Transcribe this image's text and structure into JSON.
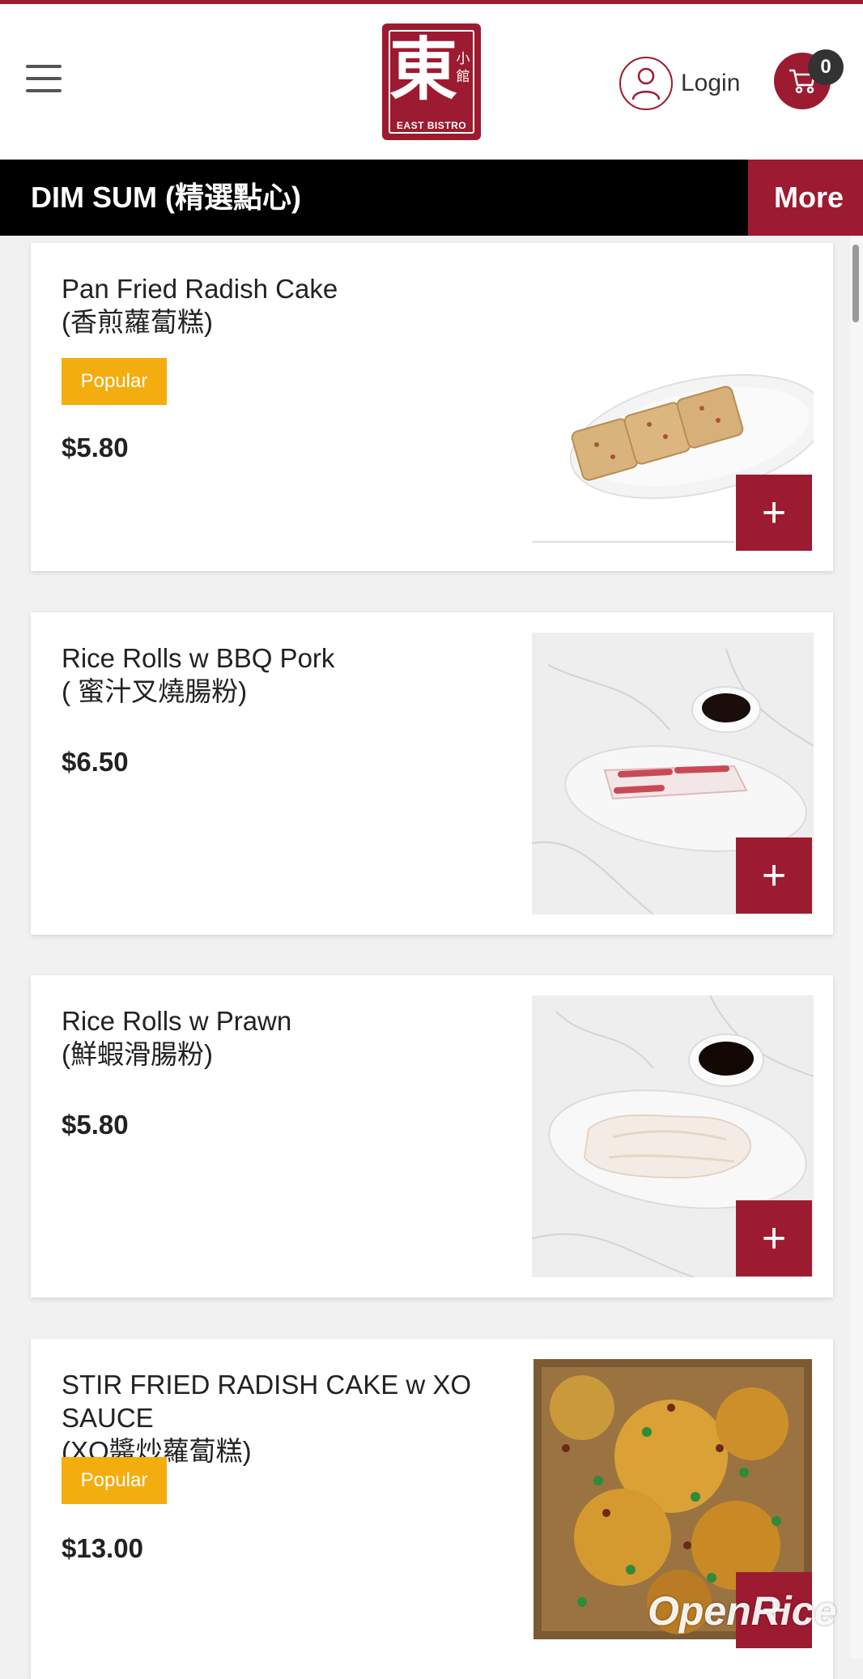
{
  "header": {
    "logo": {
      "main_char": "東",
      "side_chars": "小館",
      "name": "EAST BISTRO"
    },
    "login_label": "Login",
    "cart_count": "0"
  },
  "category_bar": {
    "title": "DIM SUM (精選點心)",
    "more_label": "More"
  },
  "items": [
    {
      "name_en": "Pan Fried Radish Cake",
      "name_zh": "(香煎蘿蔔糕)",
      "badge": "Popular",
      "price": "$5.80",
      "add_label": "+"
    },
    {
      "name_en": "Rice Rolls w BBQ Pork",
      "name_zh": "( 蜜汁叉燒腸粉)",
      "badge": "",
      "price": "$6.50",
      "add_label": "+"
    },
    {
      "name_en": "Rice Rolls w Prawn",
      "name_zh": "(鮮蝦滑腸粉)",
      "badge": "",
      "price": "$5.80",
      "add_label": "+"
    },
    {
      "name_en": "STIR FRIED RADISH CAKE w XO SAUCE",
      "name_zh": "(XO醬炒蘿蔔糕)",
      "badge": "Popular",
      "price": "$13.00",
      "add_label": "+"
    }
  ],
  "watermark": "OpenRice",
  "colors": {
    "brand_red": "#9c1b30",
    "badge_yellow": "#f4ad0e",
    "bar_black": "#000000"
  }
}
